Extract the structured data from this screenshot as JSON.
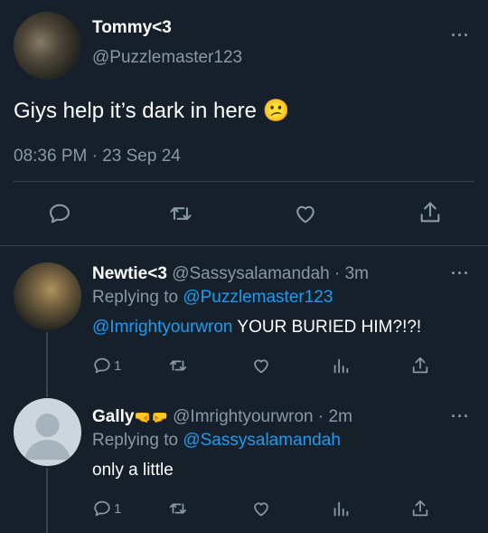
{
  "main_tweet": {
    "display_name": "Tommy<3",
    "handle": "@Puzzlemaster123",
    "text": "Giys help it’s dark in here",
    "emoji": "😕",
    "time": "08:36 PM",
    "separator": "·",
    "date": "23 Sep 24",
    "more": "···"
  },
  "replies": [
    {
      "display_name": "Newtie<3",
      "meta": "@Sassysalamandah · 3m",
      "replying_prefix": "Replying to",
      "replying_to": "@Puzzlemaster123",
      "mention": "@Imrightyourwron",
      "text": " YOUR BURIED HIM?!?!",
      "reply_count": "1",
      "more": "···"
    },
    {
      "display_name": "Gally",
      "emojis": "🤜🤛",
      "meta": "@Imrightyourwron · 2m",
      "replying_prefix": "Replying to",
      "replying_to": "@Sassysalamandah",
      "text": "only a little",
      "reply_count": "1",
      "more": "···"
    }
  ],
  "icons": [
    "reply-icon",
    "retweet-icon",
    "like-icon",
    "analytics-icon",
    "share-icon"
  ],
  "colors": {
    "background": "#15202b",
    "link": "#1d9bf0",
    "muted": "#8899a6",
    "divider": "#38444d"
  }
}
